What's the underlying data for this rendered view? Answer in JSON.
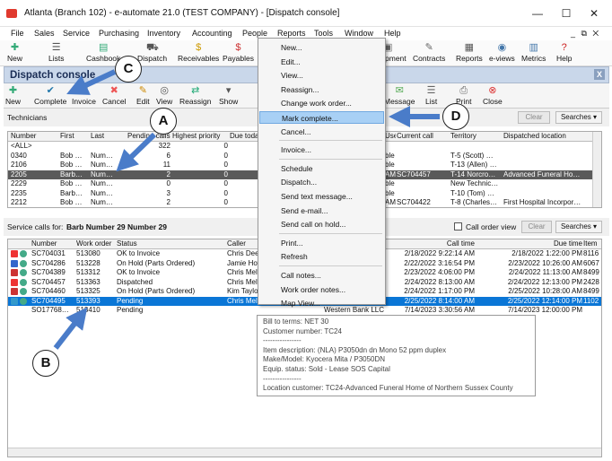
{
  "window": {
    "title": "Atlanta (Branch 102) - e-automate 21.0  (TEST COMPANY) - [Dispatch console]",
    "minimize": "—",
    "maximize": "☐",
    "close": "✕"
  },
  "menubar": {
    "items": [
      "File",
      "Sales",
      "Service",
      "Purchasing",
      "Inventory",
      "Accounting",
      "People",
      "Reports",
      "Tools",
      "Window",
      "Help"
    ],
    "restore": "_ ⧉ ✕"
  },
  "toolbar": {
    "items": [
      "New",
      "Lists",
      "Cashbook",
      "Dispatch",
      "Receivables",
      "Payables",
      "Equipment",
      "Contracts",
      "Reports",
      "e-views",
      "Metrics",
      "Help"
    ]
  },
  "console": {
    "title": "Dispatch console",
    "close": "X"
  },
  "toolbar2": {
    "items": [
      "New",
      "Complete",
      "Invoice",
      "Cancel",
      "Edit",
      "View",
      "Reassign",
      "Show",
      "Message",
      "List",
      "Print",
      "Close"
    ]
  },
  "technicians": {
    "label": "Technicians",
    "clear": "Clear",
    "searches": "Searches",
    "headers": [
      "Number",
      "First",
      "Last",
      "Pending calls",
      "Highest priority",
      "Due today",
      "",
      "Used",
      "Current call",
      "Territory",
      "Dispatched location"
    ],
    "rows": [
      [
        "<ALL>",
        "",
        "",
        "322",
        "0",
        "32",
        "",
        "",
        "",
        "",
        ""
      ],
      [
        "0340",
        "Bob …",
        "Num…",
        "6",
        "0",
        "0",
        "",
        "ble",
        "",
        "T-5 (Scott) …",
        ""
      ],
      [
        "2106",
        "Bob …",
        "Num…",
        "11",
        "0",
        "0",
        "",
        "ble",
        "",
        "T-13 (Allen) …",
        ""
      ],
      [
        "2205",
        "Barb…",
        "Num…",
        "2",
        "0",
        "0",
        "",
        "AM",
        "SC704457",
        "T-14 Norcro…",
        "Advanced Funeral Ho…"
      ],
      [
        "2229",
        "Bob …",
        "Num…",
        "0",
        "0",
        "0",
        "",
        "ble",
        "",
        "New Technic…",
        ""
      ],
      [
        "2235",
        "Barb…",
        "Num…",
        "3",
        "0",
        "0",
        "",
        "ble",
        "",
        "T-10 (Tom) …",
        ""
      ],
      [
        "2212",
        "Bob …",
        "Num…",
        "2",
        "0",
        "0",
        "",
        "AM",
        "SC704422",
        "T-8 (Charles…",
        "First Hospital Incorpor…"
      ]
    ]
  },
  "service_calls": {
    "label": "Service calls for:",
    "tech": "Barb Number 29 Number 29",
    "call_order_view": "Call order view",
    "clear": "Clear",
    "searches": "Searches",
    "headers": [
      "Number",
      "Work order",
      "Status",
      "Caller",
      "",
      "Call time",
      "Due time",
      "Item"
    ],
    "rows": [
      [
        "SC704031",
        "513080",
        "OK to Invoice",
        "Chris Deed",
        "",
        "2/18/2022 9:22:14 AM",
        "2/18/2022 1:22:00 PM",
        "8116"
      ],
      [
        "SC704286",
        "513228",
        "On Hold (Parts Ordered)",
        "Jamie How",
        "",
        "2/22/2022 3:16:54 PM",
        "2/23/2022 10:26:00 AM",
        "6067"
      ],
      [
        "SC704389",
        "513312",
        "OK to Invoice",
        "Chris Melt",
        "",
        "2/23/2022 4:06:00 PM",
        "2/24/2022 11:13:00 AM",
        "8499"
      ],
      [
        "SC704457",
        "513363",
        "Dispatched",
        "Chris Melt",
        "",
        "2/24/2022 8:13:00 AM",
        "2/24/2022 12:13:00 PM",
        "2428"
      ],
      [
        "SC704460",
        "513325",
        "On Hold (Parts Ordered)",
        "Kim Taylor",
        "",
        "2/24/2022 1:17:00 PM",
        "2/25/2022 10:28:00 AM",
        "8499"
      ],
      [
        "SC704495",
        "513393",
        "Pending",
        "Chris Melt",
        "Advanced Fune…",
        "2/25/2022 8:14:00 AM",
        "2/25/2022 12:14:00 PM",
        "1102"
      ],
      [
        "SO17768…",
        "513410",
        "Pending",
        "",
        "Western Bank LLC",
        "7/14/2023 3:30:56 AM",
        "7/14/2023 12:00:00 PM",
        ""
      ]
    ]
  },
  "context_menu": {
    "items": [
      "New...",
      "Edit...",
      "View...",
      "Reassign...",
      "Change work order...",
      "Mark complete...",
      "Cancel...",
      "Invoice...",
      "Cancel...",
      "Schedule",
      "Dispatch...",
      "Send text message...",
      "Send e-mail...",
      "Send call on hold...",
      "Print...",
      "Refresh",
      "Call notes...",
      "Work order notes...",
      "Map View..."
    ]
  },
  "tooltip": {
    "lines": [
      "Bill to terms:        NET 30",
      "Customer number:  TC24",
      "----------------",
      "Item description:  (NLA) P3050dn dn Mono 52 ppm duplex",
      "Make/Model:  Kyocera Mita / P3050DN",
      "Equip. status:       Sold - Lease SOS Capital",
      "----------------",
      "Location customer:     TC24-Advanced Funeral Home of Northern Sussex County"
    ]
  },
  "callouts": {
    "a": "A",
    "b": "B",
    "c": "C",
    "d": "D"
  },
  "colors": {
    "accent": "#0a76d6",
    "callout_arrow": "#4a7cc9"
  }
}
